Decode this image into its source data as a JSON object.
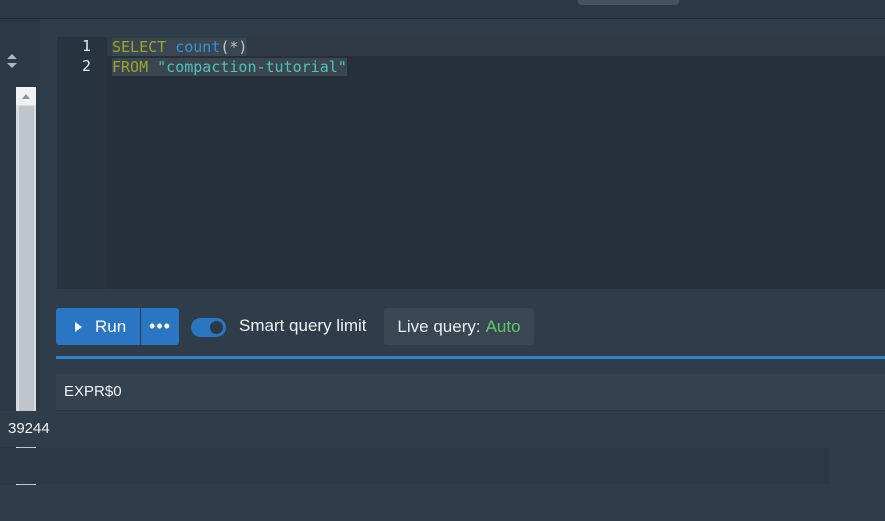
{
  "editor": {
    "lines": [
      {
        "number": "1",
        "keyword": "SELECT",
        "func": "count",
        "args": "(*)"
      },
      {
        "number": "2",
        "keyword": "FROM",
        "string": "\"compaction-tutorial\""
      }
    ]
  },
  "toolbar": {
    "run_label": "Run",
    "more_label": "•••",
    "smart_query_label": "Smart query limit",
    "smart_query_enabled": true,
    "live_query_label": "Live query:",
    "live_query_value": "Auto"
  },
  "results": {
    "columns": [
      "EXPR$0"
    ],
    "rows": [
      [
        "39244"
      ]
    ]
  },
  "icons": {
    "sort": "sort-updown-icon",
    "play": "play-icon",
    "scroll_up": "chevron-up-icon"
  },
  "colors": {
    "accent": "#2a76c2",
    "live_auto": "#63c56b",
    "keyword": "#9aa62b",
    "function": "#3a8fd8",
    "string": "#4fc3b8"
  }
}
